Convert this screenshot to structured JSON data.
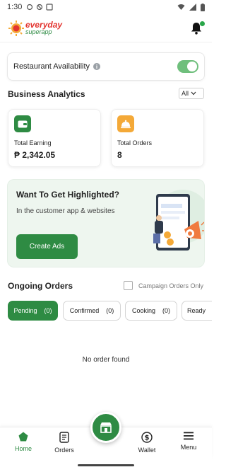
{
  "status_bar": {
    "time": "1:30"
  },
  "header": {
    "logo_line1": "everyday",
    "logo_line2": "superapp"
  },
  "availability": {
    "label": "Restaurant Availability",
    "info_glyph": "i",
    "enabled": true
  },
  "analytics": {
    "title": "Business Analytics",
    "filter_value": "All",
    "cards": [
      {
        "label": "Total Earning",
        "value": "₱ 2,342.05",
        "icon": "wallet-icon",
        "color": "#2e8b43"
      },
      {
        "label": "Total Orders",
        "value": "8",
        "icon": "cloche-icon",
        "color": "#f4a938"
      }
    ]
  },
  "promo": {
    "title": "Want To Get Highlighted?",
    "subtitle": "In the customer app & websites",
    "button": "Create Ads"
  },
  "orders": {
    "title": "Ongoing Orders",
    "campaign_label": "Campaign Orders Only",
    "tabs": [
      {
        "label": "Pending",
        "count": "(0)",
        "active": true
      },
      {
        "label": "Confirmed",
        "count": "(0)",
        "active": false
      },
      {
        "label": "Cooking",
        "count": "(0)",
        "active": false
      },
      {
        "label": "Ready",
        "count": "",
        "active": false
      }
    ],
    "empty_text": "No order found"
  },
  "bottom_nav": {
    "items": [
      {
        "label": "Home",
        "icon": "home-icon",
        "active": true
      },
      {
        "label": "Orders",
        "icon": "orders-icon",
        "active": false
      },
      {
        "label": "Wallet",
        "icon": "wallet-dollar-icon",
        "active": false
      },
      {
        "label": "Menu",
        "icon": "menu-icon",
        "active": false
      }
    ],
    "center_icon": "store-icon"
  },
  "colors": {
    "primary": "#2e8b43",
    "accent_orange": "#f4a938",
    "brand_red": "#e3342f",
    "toggle_on": "#6fbf7c"
  }
}
